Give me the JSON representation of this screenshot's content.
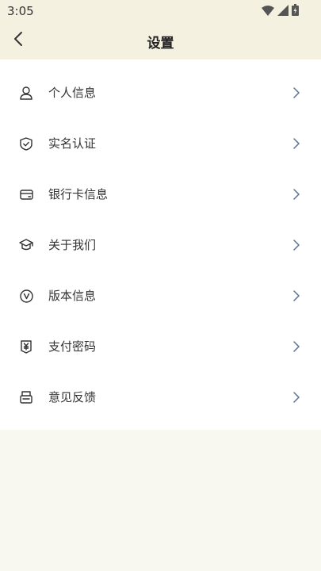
{
  "status_bar": {
    "time": "3:05",
    "icons": [
      "wifi-icon",
      "cellular-signal-icon",
      "battery-icon"
    ]
  },
  "header": {
    "title": "设置",
    "back_icon": "chevron-left-icon",
    "background": "#f4f1e1"
  },
  "menu": {
    "items": [
      {
        "label": "个人信息",
        "icon": "person-icon"
      },
      {
        "label": "实名认证",
        "icon": "shield-check-icon"
      },
      {
        "label": "银行卡信息",
        "icon": "bank-card-icon"
      },
      {
        "label": "关于我们",
        "icon": "graduation-cap-icon"
      },
      {
        "label": "版本信息",
        "icon": "version-v-icon"
      },
      {
        "label": "支付密码",
        "icon": "payment-yuan-icon"
      },
      {
        "label": "意见反馈",
        "icon": "feedback-printer-icon"
      }
    ],
    "chevron_icon": "chevron-right-icon",
    "chevron_color": "#5b6f99"
  },
  "colors": {
    "page_background": "#f8f7f0",
    "card_background": "#ffffff",
    "text": "#333333"
  }
}
